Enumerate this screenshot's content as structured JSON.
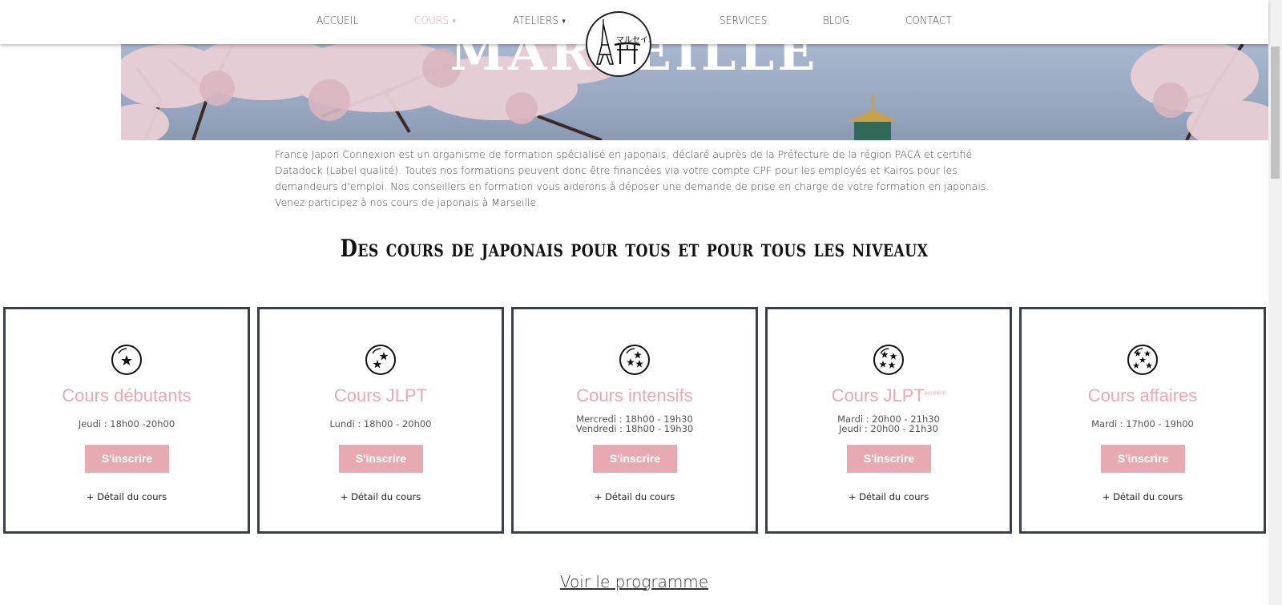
{
  "nav": {
    "items": [
      {
        "label": "ACCUEIL"
      },
      {
        "label": "COURS",
        "active": true,
        "dropdown": true
      },
      {
        "label": "ATELIERS",
        "dropdown": true
      },
      {
        "label": "SERVICES"
      },
      {
        "label": "BLOG"
      },
      {
        "label": "CONTACT"
      }
    ],
    "logo_text": "マルセイユ",
    "active_color": "#e6a5ad"
  },
  "hero": {
    "title": "MARSEILLE"
  },
  "intro": {
    "text": "France Japon Connexion est un organisme de formation spécialisé en japonais, déclaré auprès de la Préfecture de la région PACA et certifié Datadock (Label qualité). Toutes nos formations peuvent donc être financées via votre compte CPF pour les employés et Kairos pour les demandeurs d'emploi. Nos conseillers en formation vous aiderons à déposer une demande de prise en charge de votre formation en japonais. Venez participez à nos cours de japonais à Marseille."
  },
  "section_title": "Des cours de japonais pour tous et pour tous les niveaux",
  "cards": [
    {
      "icon": "one-star-ball-icon",
      "title": "Cours débutants",
      "schedule": [
        "Jeudi : 18h00 -20h00"
      ],
      "button": "S'inscrire",
      "detail": "+ Détail du cours"
    },
    {
      "icon": "two-star-ball-icon",
      "title": "Cours JLPT",
      "schedule": [
        "Lundi : 18h00 - 20h00"
      ],
      "button": "S'inscrire",
      "detail": "+ Détail du cours"
    },
    {
      "icon": "three-star-ball-icon",
      "title": "Cours intensifs",
      "schedule": [
        "Mercredi : 18h00 - 19h30",
        "Vendredi : 18h00 - 19h30"
      ],
      "button": "S'inscrire",
      "detail": "+ Détail du cours"
    },
    {
      "icon": "four-star-ball-icon",
      "title": "Cours JLPT",
      "title_sup": "accéléré",
      "schedule": [
        "Mardi : 20h00 - 21h30",
        "Jeudi : 20h00 - 21h30"
      ],
      "button": "S'inscrire",
      "detail": "+ Détail du cours"
    },
    {
      "icon": "five-star-ball-icon",
      "title": "Cours affaires",
      "schedule": [
        "Mardi : 17h00 - 19h00"
      ],
      "button": "S'inscrire",
      "detail": "+ Détail du cours"
    }
  ],
  "programme_link": "Voir le programme",
  "colors": {
    "accent_pink": "#e8aab1",
    "card_border": "#3a4049"
  }
}
